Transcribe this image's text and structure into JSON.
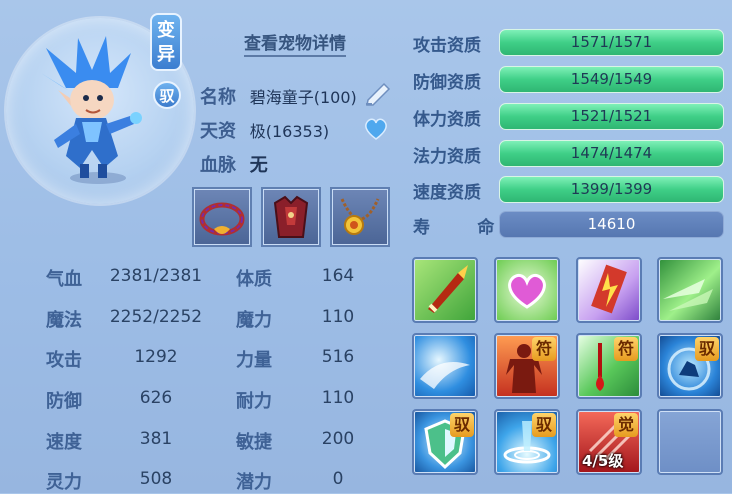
{
  "pet": {
    "mutation_tag": [
      "变",
      "异"
    ],
    "ride_tag": "驭",
    "detail_link": "查看宠物详情",
    "name_label": "名称",
    "name_value": "碧海童子(100)",
    "talent_label": "天资",
    "talent_value": "极(16353)",
    "bloodline_label": "血脉",
    "bloodline_value": "无"
  },
  "aptitudes": [
    {
      "label": "攻击资质",
      "value": "1571/1571",
      "fill": 1.0
    },
    {
      "label": "防御资质",
      "value": "1549/1549",
      "fill": 1.0
    },
    {
      "label": "体力资质",
      "value": "1521/1521",
      "fill": 1.0
    },
    {
      "label": "法力资质",
      "value": "1474/1474",
      "fill": 1.0
    },
    {
      "label": "速度资质",
      "value": "1399/1399",
      "fill": 1.0
    },
    {
      "label": "寿        命",
      "value": "14610"
    }
  ],
  "stats_left": [
    {
      "label": "气血",
      "value": "2381/2381"
    },
    {
      "label": "魔法",
      "value": "2252/2252"
    },
    {
      "label": "攻击",
      "value": "1292"
    },
    {
      "label": "防御",
      "value": "626"
    },
    {
      "label": "速度",
      "value": "381"
    },
    {
      "label": "灵力",
      "value": "508"
    }
  ],
  "stats_right": [
    {
      "label": "体质",
      "value": "164"
    },
    {
      "label": "魔力",
      "value": "110"
    },
    {
      "label": "力量",
      "value": "516"
    },
    {
      "label": "耐力",
      "value": "110"
    },
    {
      "label": "敏捷",
      "value": "200"
    },
    {
      "label": "潜力",
      "value": "0"
    }
  ],
  "skills": {
    "badges": {
      "s6": "符",
      "s7": "符",
      "s8": "驭",
      "s9": "驭",
      "s10": "驭",
      "s11": "觉"
    },
    "level_text": "4/5级"
  },
  "colors": {
    "aptitude_bar": "#3fcf87",
    "life_bar": "#5677b1",
    "badge": "#f0b13a"
  }
}
